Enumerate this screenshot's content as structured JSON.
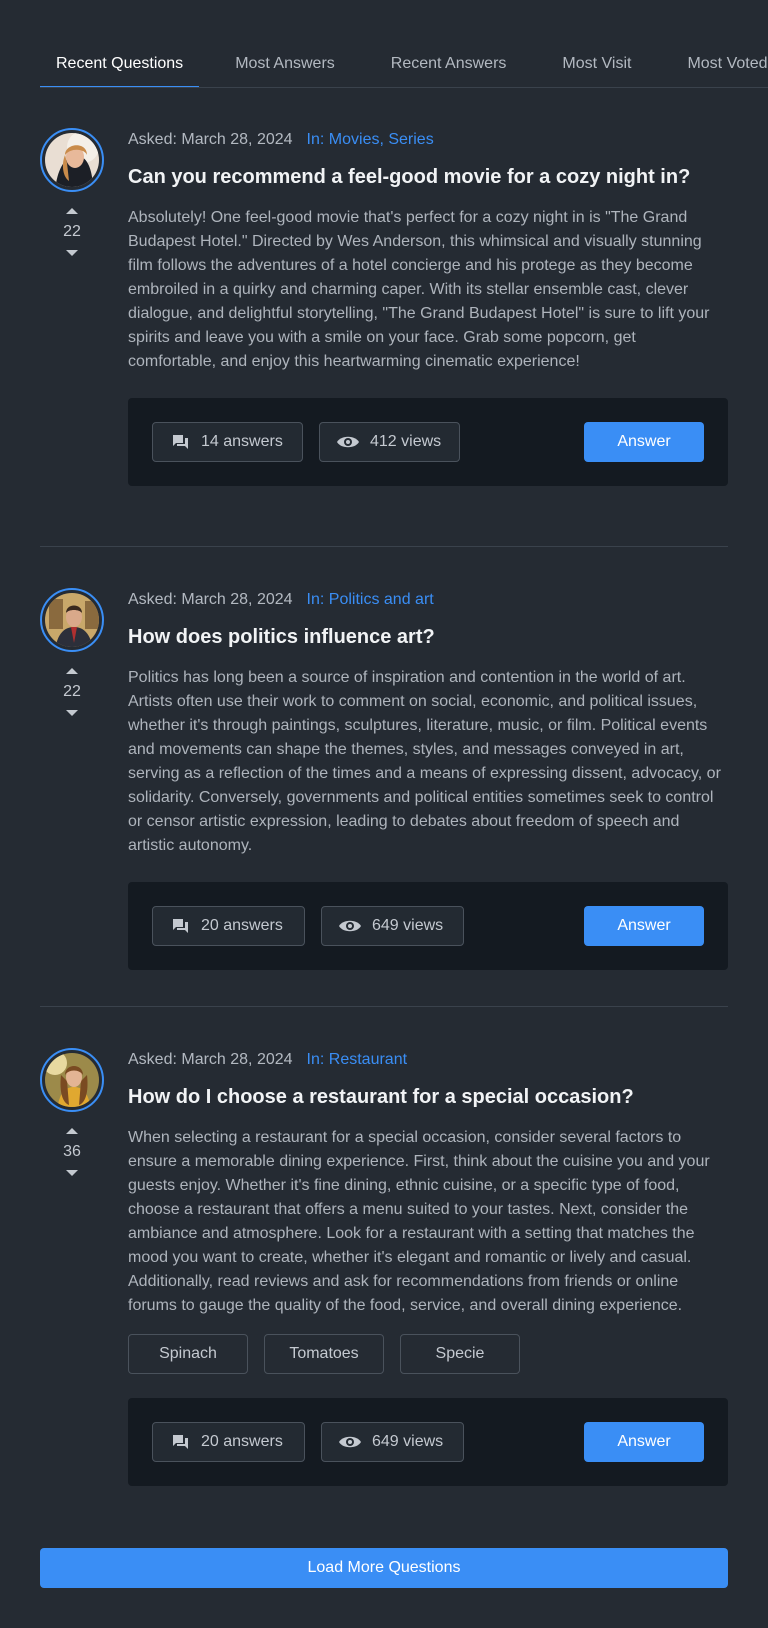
{
  "tabs": [
    {
      "label": "Recent Questions",
      "active": true
    },
    {
      "label": "Most Answers"
    },
    {
      "label": "Recent Answers"
    },
    {
      "label": "Most Visit"
    },
    {
      "label": "Most Voted"
    }
  ],
  "questions": [
    {
      "asked": "Asked: March 28, 2024",
      "category": "In: Movies, Series",
      "title": "Can you recommend a feel-good movie for a cozy night in?",
      "text": "Absolutely! One feel-good movie that's perfect for a cozy night in is \"The Grand Budapest Hotel.\" Directed by Wes Anderson, this whimsical and visually stunning film follows the adventures of a hotel concierge and his protege as they become embroiled in a quirky and charming caper. With its stellar ensemble cast, clever dialogue, and delightful storytelling, \"The Grand Budapest Hotel\" is sure to lift your spirits and leave you with a smile on your face. Grab some popcorn, get comfortable, and enjoy this heartwarming cinematic experience!",
      "votes": "22",
      "answers": "14 answers",
      "views": "412 views",
      "answer_label": "Answer"
    },
    {
      "asked": "Asked: March 28, 2024",
      "category": "In: Politics and art",
      "title": "How does politics influence art?",
      "text": "Politics has long been a source of inspiration and contention in the world of art. Artists often use their work to comment on social, economic, and political issues, whether it's through paintings, sculptures, literature, music, or film. Political events and movements can shape the themes, styles, and messages conveyed in art, serving as a reflection of the times and a means of expressing dissent, advocacy, or solidarity. Conversely, governments and political entities sometimes seek to control or censor artistic expression, leading to debates about freedom of speech and artistic autonomy.",
      "votes": "22",
      "answers": "20 answers",
      "views": "649 views",
      "answer_label": "Answer"
    },
    {
      "asked": "Asked: March 28, 2024",
      "category": "In: Restaurant",
      "title": "How do I choose a restaurant for a special occasion?",
      "text": "When selecting a restaurant for a special occasion, consider several factors to ensure a memorable dining experience. First, think about the cuisine you and your guests enjoy. Whether it's fine dining, ethnic cuisine, or a specific type of food, choose a restaurant that offers a menu suited to your tastes. Next, consider the ambiance and atmosphere. Look for a restaurant with a setting that matches the mood you want to create, whether it's elegant and romantic or lively and casual. Additionally, read reviews and ask for recommendations from friends or online forums to gauge the quality of the food, service, and overall dining experience.",
      "votes": "36",
      "tags": [
        "Spinach",
        "Tomatoes",
        "Specie"
      ],
      "answers": "20 answers",
      "views": "649 views",
      "answer_label": "Answer"
    }
  ],
  "load_more": "Load More Questions",
  "colors": {
    "accent": "#3a8ef5",
    "background": "#252b33",
    "footer_bg": "#141a21"
  }
}
